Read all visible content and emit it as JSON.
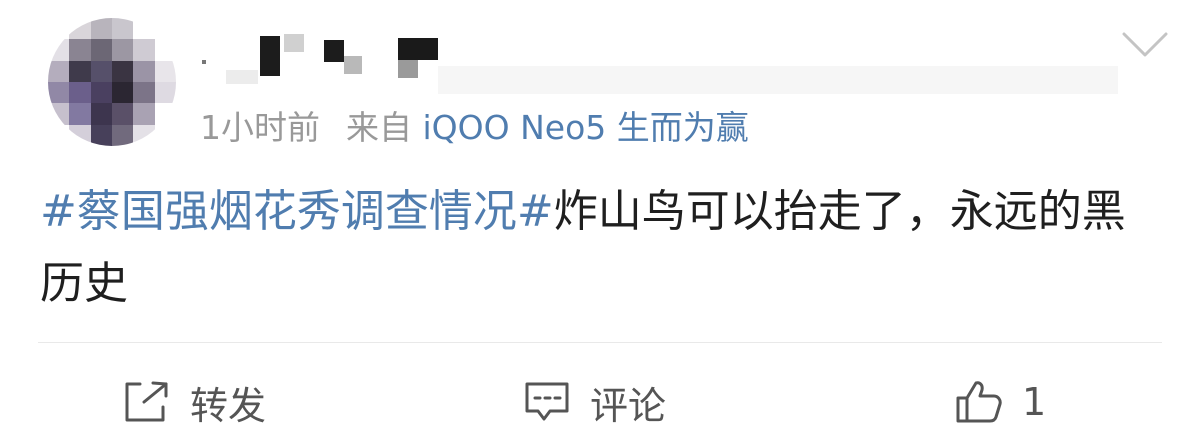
{
  "post": {
    "meta": {
      "time": "1小时前",
      "source_prefix": "来自",
      "source": "iQOO Neo5 生而为赢"
    },
    "content": {
      "topic": "#蔡国强烟花秀调查情况#",
      "text": "炸山鸟可以抬走了，永远的黑历史"
    }
  },
  "actions": {
    "repost": {
      "label": "转发",
      "icon": "share-square-icon"
    },
    "comment": {
      "label": "评论",
      "icon": "comment-bubble-icon"
    },
    "like": {
      "count": "1",
      "icon": "thumbs-up-icon"
    }
  },
  "icons": {
    "more": "chevron-down-icon"
  },
  "colors": {
    "link": "#507daf",
    "meta": "#999999",
    "text": "#1f1f1f",
    "action": "#555555",
    "divider": "#e9e9e9"
  }
}
